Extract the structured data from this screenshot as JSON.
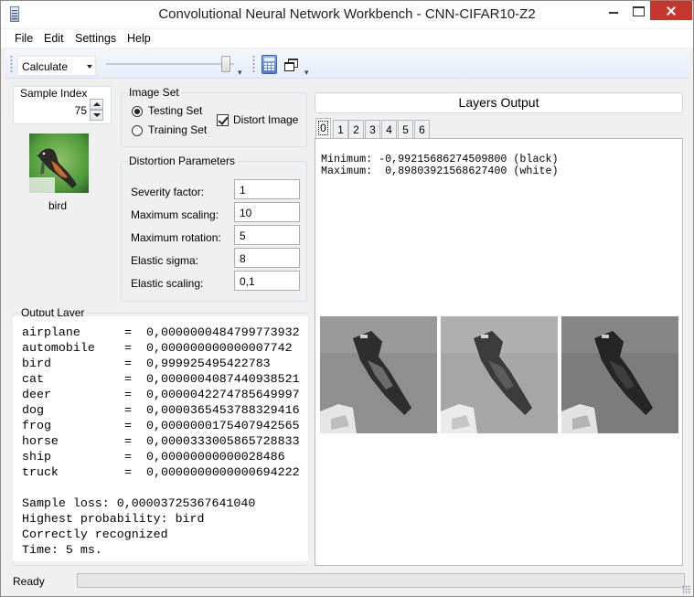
{
  "window": {
    "title": "Convolutional Neural Network Workbench - CNN-CIFAR10-Z2"
  },
  "menu": {
    "items": [
      "File",
      "Edit",
      "Settings",
      "Help"
    ]
  },
  "toolbar": {
    "mode_selected": "Calculate"
  },
  "sample_index": {
    "label": "Sample Index",
    "value": "75"
  },
  "sample_image": {
    "label": "bird"
  },
  "image_set": {
    "label": "Image Set",
    "testing_label": "Testing Set",
    "training_label": "Training Set",
    "selected": "Testing Set",
    "distort_label": "Distort Image",
    "distort_checked": true
  },
  "distortion": {
    "label": "Distortion Parameters",
    "params": [
      {
        "label": "Severity factor:",
        "value": "1"
      },
      {
        "label": "Maximum scaling:",
        "value": "10"
      },
      {
        "label": "Maximum rotation:",
        "value": "5"
      },
      {
        "label": "Elastic sigma:",
        "value": "8"
      },
      {
        "label": "Elastic scaling:",
        "value": "0,1"
      }
    ]
  },
  "output_layer": {
    "label": "Output Layer",
    "rows": [
      {
        "name": "airplane",
        "value": "0,0000000484799773932"
      },
      {
        "name": "automobile",
        "value": "0,000000000000007742"
      },
      {
        "name": "bird",
        "value": "0,999925495422783"
      },
      {
        "name": "cat",
        "value": "0,0000004087440938521"
      },
      {
        "name": "deer",
        "value": "0,0000042274785649997"
      },
      {
        "name": "dog",
        "value": "0,0000365453788329416"
      },
      {
        "name": "frog",
        "value": "0,0000000175407942565"
      },
      {
        "name": "horse",
        "value": "0,0000333005865728833"
      },
      {
        "name": "ship",
        "value": "0,00000000000028486"
      },
      {
        "name": "truck",
        "value": "0,0000000000000694222"
      }
    ],
    "equals": "=",
    "summary": [
      "Sample loss: 0,00003725367641040",
      "Highest probability: bird",
      "Correctly recognized",
      "Time: 5 ms."
    ]
  },
  "layers": {
    "button_label": "Layers Output",
    "tabs": [
      "0",
      "1",
      "2",
      "3",
      "4",
      "5",
      "6"
    ],
    "active_tab": "0",
    "minimum_line": "Minimum: -0,99215686274509800 (black)",
    "maximum_line": "Maximum:  0,89803921568627400 (white)"
  },
  "status": {
    "text": "Ready",
    "progress": 0
  }
}
